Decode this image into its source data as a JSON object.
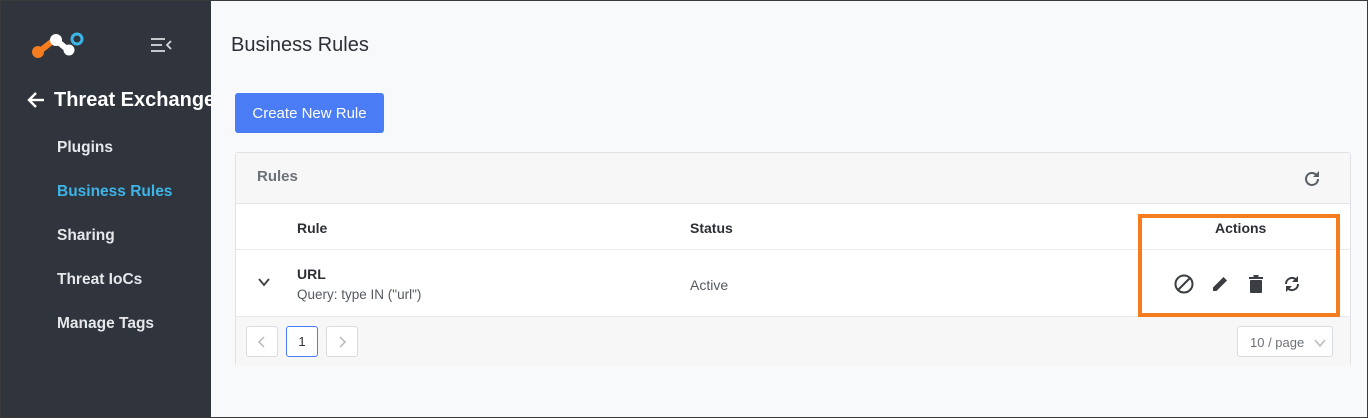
{
  "sidebar": {
    "back_label": "Threat Exchange",
    "items": [
      {
        "label": "Plugins",
        "active": false
      },
      {
        "label": "Business Rules",
        "active": true
      },
      {
        "label": "Sharing",
        "active": false
      },
      {
        "label": "Threat IoCs",
        "active": false
      },
      {
        "label": "Manage Tags",
        "active": false
      }
    ]
  },
  "main": {
    "title": "Business Rules",
    "create_button": "Create New Rule",
    "card": {
      "title": "Rules",
      "columns": {
        "rule": "Rule",
        "status": "Status",
        "actions": "Actions"
      },
      "rows": [
        {
          "name": "URL",
          "query": "Query: type IN (\"url\")",
          "status": "Active"
        }
      ],
      "pagination": {
        "current_page": "1",
        "page_size": "10 / page"
      }
    }
  },
  "icons": [
    "logo-icon",
    "menu-collapse-icon",
    "arrow-left-icon",
    "refresh-icon",
    "chevron-down-icon",
    "disable-icon",
    "edit-icon",
    "delete-icon",
    "sync-icon",
    "chevron-left-icon",
    "chevron-right-icon"
  ],
  "colors": {
    "sidebar_bg": "#2f343d",
    "active_nav": "#3db5e6",
    "primary_button": "#4a7cf6",
    "highlight_box": "#f57c1f"
  }
}
